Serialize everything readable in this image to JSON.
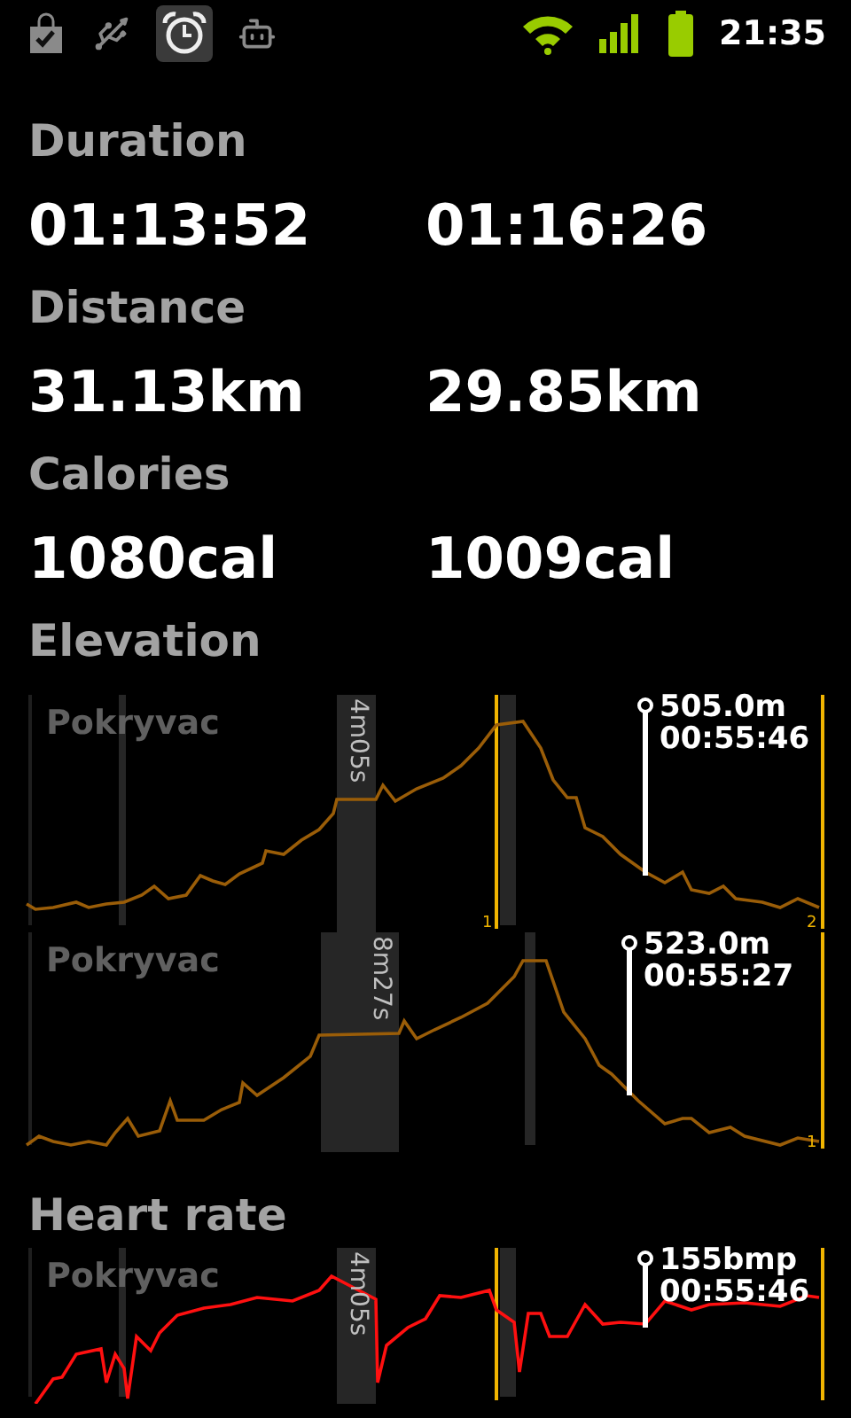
{
  "status_bar": {
    "time": "21:35"
  },
  "stats": [
    {
      "label": "Duration",
      "values": [
        "01:13:52",
        "01:16:26"
      ]
    },
    {
      "label": "Distance",
      "values": [
        "31.13km",
        "29.85km"
      ]
    },
    {
      "label": "Calories",
      "values": [
        "1080cal",
        "1009cal"
      ]
    }
  ],
  "elevation": {
    "title": "Elevation",
    "charts": [
      {
        "track": "Pokryvac",
        "pause": "4m05s",
        "marker": {
          "value": "505.0m",
          "time": "00:55:46"
        },
        "laps": [
          "1",
          "2"
        ]
      },
      {
        "track": "Pokryvac",
        "pause": "8m27s",
        "marker": {
          "value": "523.0m",
          "time": "00:55:27"
        },
        "laps": [
          "1"
        ]
      }
    ]
  },
  "heart_rate": {
    "title": "Heart rate",
    "chart": {
      "track": "Pokryvac",
      "pause": "4m05s",
      "marker": {
        "value": "155bmp",
        "time": "00:55:46"
      }
    }
  }
}
